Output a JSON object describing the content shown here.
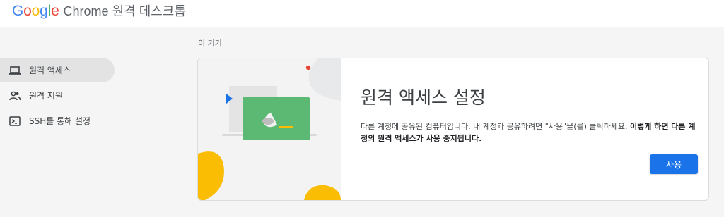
{
  "app": {
    "logo_letters": [
      {
        "ch": "G",
        "color": "#4285F4"
      },
      {
        "ch": "o",
        "color": "#EA4335"
      },
      {
        "ch": "o",
        "color": "#FBBC05"
      },
      {
        "ch": "g",
        "color": "#4285F4"
      },
      {
        "ch": "l",
        "color": "#34A853"
      },
      {
        "ch": "e",
        "color": "#EA4335"
      }
    ],
    "product_name": "Chrome 원격 데스크톱"
  },
  "sidebar": {
    "items": [
      {
        "label": "원격 액세스",
        "icon": "laptop-icon",
        "active": true
      },
      {
        "label": "원격 지원",
        "icon": "people-icon",
        "active": false
      },
      {
        "label": "SSH를 통해 설정",
        "icon": "terminal-icon",
        "active": false
      }
    ]
  },
  "main": {
    "section_label": "이 기기",
    "card": {
      "title": "원격 액세스 설정",
      "desc_regular": "다른 계정에 공유된 컴퓨터입니다. 내 계정과 공유하려면 \"사용\"을(를) 클릭하세요. ",
      "desc_bold": "이렇게 하면 다른 계정의 원격 액세스가 사용 중지됩니다.",
      "button_label": "사용"
    }
  },
  "colors": {
    "accent": "#1a73e8",
    "illustration_green": "#5bb974",
    "illustration_yellow": "#fbbc04",
    "illustration_red": "#ea4335"
  }
}
